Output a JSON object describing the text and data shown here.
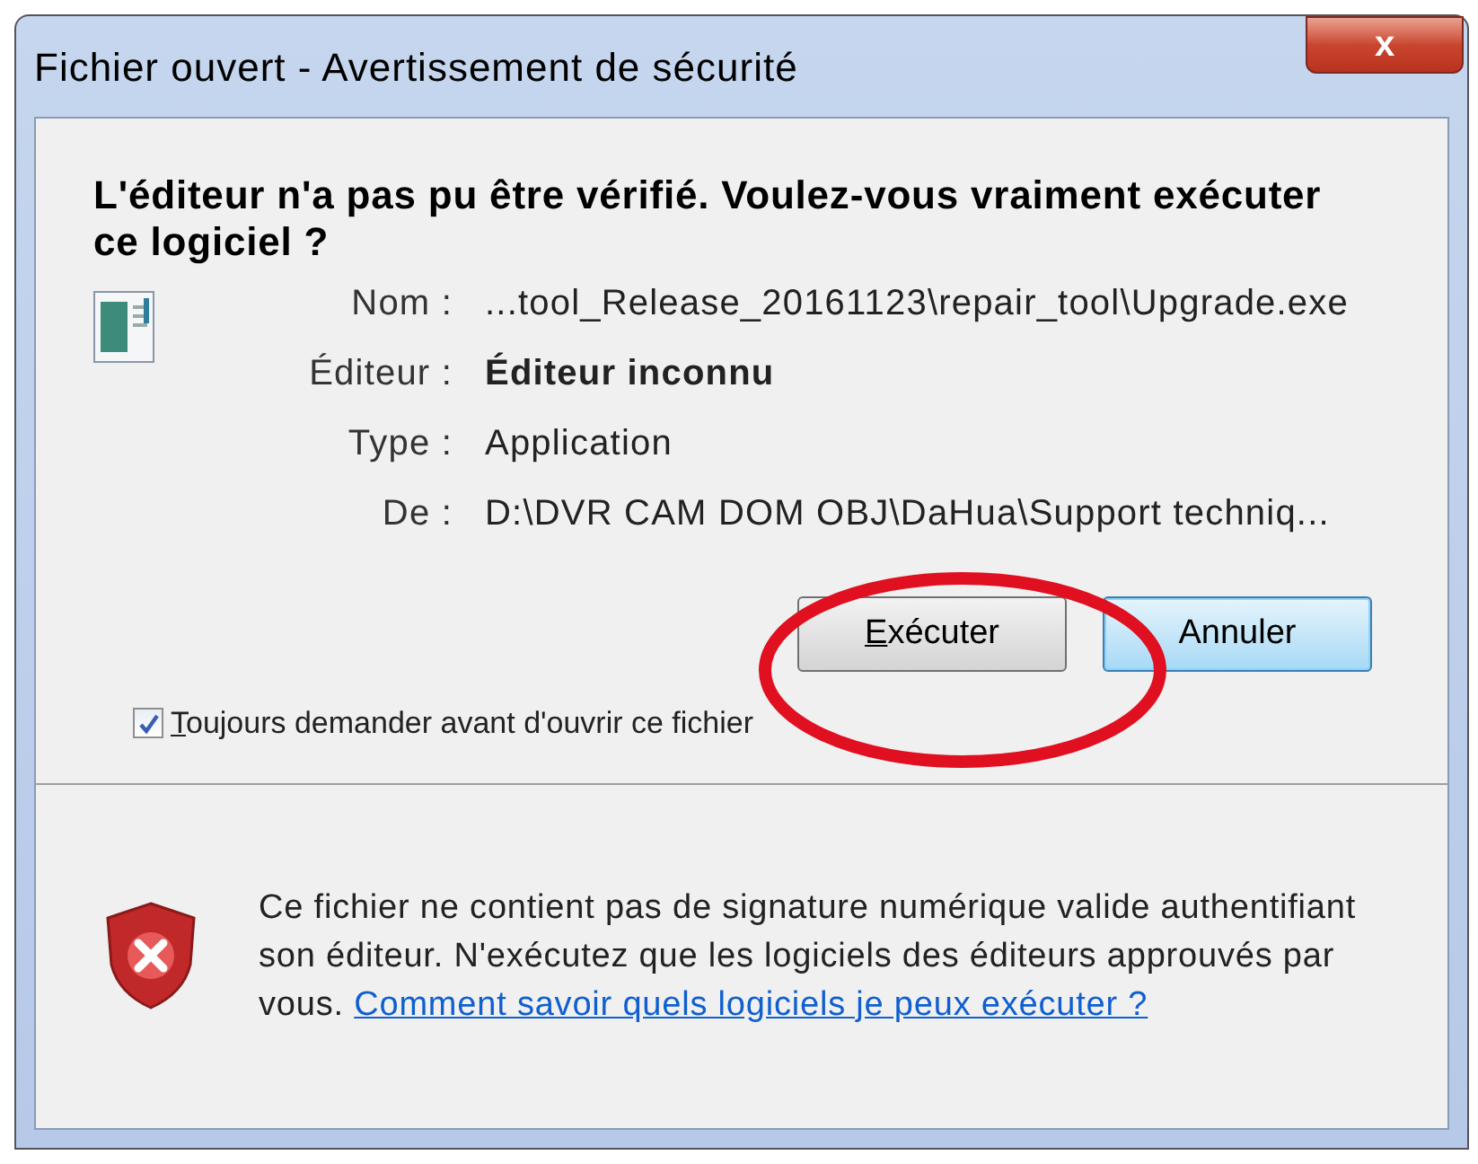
{
  "window": {
    "title": "Fichier ouvert - Avertissement de sécurité",
    "close": "x"
  },
  "heading": "L'éditeur n'a pas pu être vérifié. Voulez-vous vraiment exécuter ce logiciel ?",
  "details": [
    {
      "label": "Nom :",
      "value": "...tool_Release_20161123\\repair_tool\\Upgrade.exe",
      "bold": false
    },
    {
      "label": "Éditeur :",
      "value": "Éditeur inconnu",
      "bold": true
    },
    {
      "label": "Type :",
      "value": "Application",
      "bold": false
    },
    {
      "label": "De :",
      "value": "D:\\DVR CAM DOM OBJ\\DaHua\\Support techniq...",
      "bold": false
    }
  ],
  "buttons": [
    {
      "label": "Exécuter",
      "access_key": true,
      "default": false
    },
    {
      "label": "Annuler",
      "access_key": false,
      "default": true
    }
  ],
  "checkbox": {
    "label": "Toujours demander avant d'ouvrir ce fichier",
    "checked": true,
    "access_key": true
  },
  "warning": {
    "text": "Ce fichier ne contient pas de signature numérique valide authentifiant son éditeur. N'exécutez que les logiciels des éditeurs approuvés par vous.",
    "link": "Comment savoir quels logiciels je peux exécuter ?"
  }
}
